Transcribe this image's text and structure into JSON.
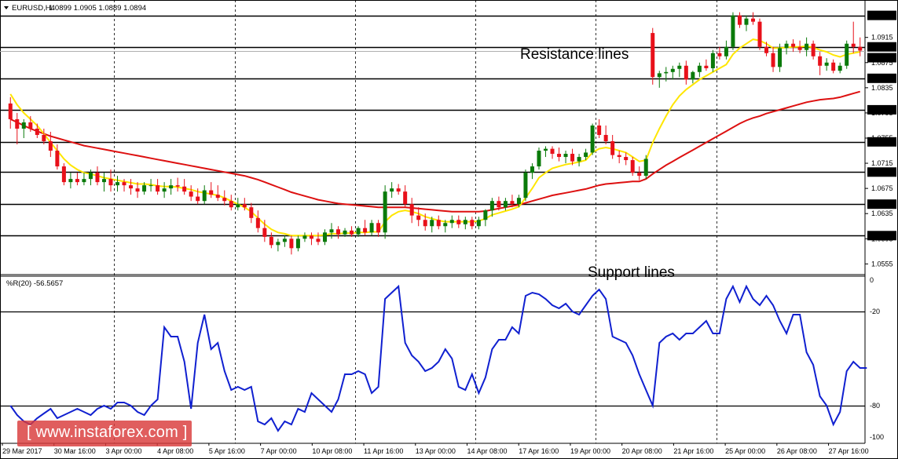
{
  "header": {
    "symbol": "EURUSD,H4",
    "ohlc": "1.0899 1.0905 1.0889 1.0894"
  },
  "annotations": {
    "resistance": "Resistance lines",
    "support": "Support lines"
  },
  "watermark": "[ www.instaforex.com ]",
  "colors": {
    "bull": "#0a7a0a",
    "bear": "#e8101a",
    "ma_fast": "#ffe600",
    "ma_slow": "#dd1010",
    "wpr": "#1020d0",
    "hline": "#000000"
  },
  "chart_data": [
    {
      "type": "candlestick",
      "title": "EURUSD,H4",
      "ylim": [
        1.0538,
        1.0962
      ],
      "price_ticks": [
        "1.0915",
        "1.0875",
        "1.0835",
        "1.0795",
        "1.0755",
        "1.0715",
        "1.0675",
        "1.0635",
        "1.0595",
        "1.0555"
      ],
      "highlighted_levels": [
        "1.0950",
        "1.0900",
        "1.0850",
        "1.0800",
        "1.0749",
        "1.0701",
        "1.0650",
        "1.0600"
      ],
      "current_price": "1.0894",
      "levels": [
        1.095,
        1.09,
        1.085,
        1.08,
        1.0749,
        1.0701,
        1.065,
        1.06
      ],
      "time_labels": [
        "29 Mar 2017",
        "30 Mar 16:00",
        "3 Apr 00:00",
        "4 Apr 08:00",
        "5 Apr 16:00",
        "7 Apr 00:00",
        "10 Apr 08:00",
        "11 Apr 16:00",
        "13 Apr 00:00",
        "14 Apr 08:00",
        "17 Apr 16:00",
        "19 Apr 00:00",
        "20 Apr 08:00",
        "21 Apr 16:00",
        "25 Apr 00:00",
        "26 Apr 08:00",
        "27 Apr 16:00"
      ],
      "candles": [
        [
          1.081,
          1.082,
          1.077,
          1.0785
        ],
        [
          1.0785,
          1.0795,
          1.0745,
          1.077
        ],
        [
          1.077,
          1.0785,
          1.0755,
          1.078
        ],
        [
          1.078,
          1.079,
          1.0765,
          1.077
        ],
        [
          1.077,
          1.0778,
          1.0755,
          1.076
        ],
        [
          1.076,
          1.077,
          1.0745,
          1.075
        ],
        [
          1.075,
          1.0765,
          1.0725,
          1.0735
        ],
        [
          1.0735,
          1.0745,
          1.0705,
          1.071
        ],
        [
          1.071,
          1.0715,
          1.068,
          1.0685
        ],
        [
          1.0685,
          1.07,
          1.0675,
          1.069
        ],
        [
          1.069,
          1.07,
          1.068,
          1.0685
        ],
        [
          1.0685,
          1.07,
          1.068,
          1.069
        ],
        [
          1.069,
          1.0705,
          1.068,
          1.07
        ],
        [
          1.07,
          1.071,
          1.068,
          1.0685
        ],
        [
          1.0685,
          1.07,
          1.067,
          1.069
        ],
        [
          1.069,
          1.0705,
          1.067,
          1.068
        ],
        [
          1.068,
          1.0695,
          1.067,
          1.0685
        ],
        [
          1.0685,
          1.069,
          1.067,
          1.068
        ],
        [
          1.068,
          1.069,
          1.0665,
          1.0675
        ],
        [
          1.0675,
          1.0685,
          1.066,
          1.067
        ],
        [
          1.067,
          1.0685,
          1.0665,
          1.068
        ],
        [
          1.068,
          1.069,
          1.067,
          1.068
        ],
        [
          1.068,
          1.069,
          1.0665,
          1.067
        ],
        [
          1.067,
          1.0685,
          1.066,
          1.0675
        ],
        [
          1.0675,
          1.069,
          1.0665,
          1.068
        ],
        [
          1.068,
          1.0692,
          1.067,
          1.0678
        ],
        [
          1.0678,
          1.069,
          1.0665,
          1.067
        ],
        [
          1.067,
          1.068,
          1.0655,
          1.0662
        ],
        [
          1.0662,
          1.0675,
          1.065,
          1.0655
        ],
        [
          1.0655,
          1.068,
          1.065,
          1.0672
        ],
        [
          1.0672,
          1.0685,
          1.066,
          1.0665
        ],
        [
          1.0665,
          1.068,
          1.0655,
          1.066
        ],
        [
          1.066,
          1.0672,
          1.0648,
          1.0655
        ],
        [
          1.0655,
          1.0665,
          1.064,
          1.0645
        ],
        [
          1.0645,
          1.066,
          1.064,
          1.065
        ],
        [
          1.065,
          1.066,
          1.064,
          1.0645
        ],
        [
          1.0645,
          1.0652,
          1.062,
          1.0628
        ],
        [
          1.0628,
          1.064,
          1.0605,
          1.0612
        ],
        [
          1.0612,
          1.0625,
          1.059,
          1.0598
        ],
        [
          1.0598,
          1.0605,
          1.058,
          1.0585
        ],
        [
          1.0585,
          1.0595,
          1.0575,
          1.059
        ],
        [
          1.059,
          1.06,
          1.0582,
          1.0595
        ],
        [
          1.0595,
          1.06,
          1.057,
          1.058
        ],
        [
          1.058,
          1.06,
          1.0575,
          1.0595
        ],
        [
          1.0595,
          1.0605,
          1.059,
          1.06
        ],
        [
          1.06,
          1.0605,
          1.0585,
          1.0595
        ],
        [
          1.0595,
          1.0605,
          1.0585,
          1.059
        ],
        [
          1.059,
          1.061,
          1.0585,
          1.0605
        ],
        [
          1.0605,
          1.062,
          1.0595,
          1.061
        ],
        [
          1.061,
          1.0615,
          1.0595,
          1.0602
        ],
        [
          1.0602,
          1.0612,
          1.0598,
          1.0608
        ],
        [
          1.0608,
          1.0615,
          1.0598,
          1.0602
        ],
        [
          1.0602,
          1.0615,
          1.0598,
          1.0612
        ],
        [
          1.0612,
          1.0625,
          1.06,
          1.0605
        ],
        [
          1.0605,
          1.0625,
          1.06,
          1.062
        ],
        [
          1.062,
          1.0625,
          1.0598,
          1.0605
        ],
        [
          1.0605,
          1.068,
          1.0595,
          1.067
        ],
        [
          1.067,
          1.0685,
          1.066,
          1.0675
        ],
        [
          1.0675,
          1.0682,
          1.0665,
          1.067
        ],
        [
          1.067,
          1.068,
          1.0645,
          1.065
        ],
        [
          1.065,
          1.066,
          1.062,
          1.0632
        ],
        [
          1.0632,
          1.0645,
          1.0615,
          1.0625
        ],
        [
          1.0625,
          1.0635,
          1.0608,
          1.0615
        ],
        [
          1.0615,
          1.063,
          1.0605,
          1.0625
        ],
        [
          1.0625,
          1.0632,
          1.061,
          1.0615
        ],
        [
          1.0615,
          1.0625,
          1.0605,
          1.062
        ],
        [
          1.062,
          1.0632,
          1.0612,
          1.0625
        ],
        [
          1.0625,
          1.0632,
          1.0612,
          1.0618
        ],
        [
          1.0618,
          1.063,
          1.061,
          1.0625
        ],
        [
          1.0625,
          1.063,
          1.061,
          1.0615
        ],
        [
          1.0615,
          1.063,
          1.061,
          1.0625
        ],
        [
          1.0625,
          1.0642,
          1.0615,
          1.064
        ],
        [
          1.064,
          1.066,
          1.063,
          1.0655
        ],
        [
          1.0655,
          1.0662,
          1.064,
          1.0645
        ],
        [
          1.0645,
          1.066,
          1.064,
          1.0655
        ],
        [
          1.0655,
          1.0665,
          1.0645,
          1.065
        ],
        [
          1.065,
          1.0665,
          1.0645,
          1.066
        ],
        [
          1.066,
          1.0705,
          1.0655,
          1.07
        ],
        [
          1.07,
          1.0715,
          1.069,
          1.071
        ],
        [
          1.071,
          1.074,
          1.0705,
          1.0735
        ],
        [
          1.0735,
          1.0742,
          1.0725,
          1.0738
        ],
        [
          1.0738,
          1.0742,
          1.0722,
          1.073
        ],
        [
          1.073,
          1.074,
          1.0718,
          1.0725
        ],
        [
          1.0725,
          1.0735,
          1.0715,
          1.073
        ],
        [
          1.073,
          1.0738,
          1.0712,
          1.0718
        ],
        [
          1.0718,
          1.073,
          1.071,
          1.0725
        ],
        [
          1.0725,
          1.0738,
          1.072,
          1.0732
        ],
        [
          1.0732,
          1.0778,
          1.0728,
          1.0775
        ],
        [
          1.0775,
          1.0785,
          1.0755,
          1.076
        ],
        [
          1.076,
          1.0775,
          1.0745,
          1.075
        ],
        [
          1.075,
          1.076,
          1.0722,
          1.0728
        ],
        [
          1.0728,
          1.0735,
          1.0715,
          1.0725
        ],
        [
          1.0725,
          1.0732,
          1.0712,
          1.072
        ],
        [
          1.072,
          1.0725,
          1.0695,
          1.07
        ],
        [
          1.07,
          1.071,
          1.0688,
          1.0695
        ],
        [
          1.0695,
          1.0728,
          1.069,
          1.0722
        ],
        [
          1.0922,
          1.093,
          1.084,
          1.0852
        ],
        [
          1.0852,
          1.0862,
          1.0835,
          1.0858
        ],
        [
          1.0858,
          1.0868,
          1.0845,
          1.086
        ],
        [
          1.086,
          1.087,
          1.0848,
          1.0865
        ],
        [
          1.0865,
          1.0875,
          1.0852,
          1.087
        ],
        [
          1.087,
          1.0878,
          1.084,
          1.0848
        ],
        [
          1.0848,
          1.0862,
          1.0842,
          1.086
        ],
        [
          1.086,
          1.0875,
          1.0852,
          1.087
        ],
        [
          1.087,
          1.088,
          1.0862,
          1.0866
        ],
        [
          1.0866,
          1.0895,
          1.086,
          1.089
        ],
        [
          1.089,
          1.09,
          1.088,
          1.0885
        ],
        [
          1.0885,
          1.091,
          1.088,
          1.09
        ],
        [
          1.09,
          1.0955,
          1.0895,
          1.095
        ],
        [
          1.095,
          1.0955,
          1.093,
          1.0935
        ],
        [
          1.0935,
          1.095,
          1.0925,
          1.0945
        ],
        [
          1.0945,
          1.0955,
          1.0935,
          1.094
        ],
        [
          1.094,
          1.0945,
          1.0895,
          1.09
        ],
        [
          1.09,
          1.0908,
          1.0885,
          1.089
        ],
        [
          1.089,
          1.09,
          1.086,
          1.0868
        ],
        [
          1.0868,
          1.0905,
          1.086,
          1.0898
        ],
        [
          1.0898,
          1.091,
          1.0888,
          1.0905
        ],
        [
          1.0905,
          1.0912,
          1.0892,
          1.09
        ],
        [
          1.09,
          1.091,
          1.089,
          1.0895
        ],
        [
          1.0895,
          1.0915,
          1.0885,
          1.0905
        ],
        [
          1.0905,
          1.091,
          1.088,
          1.0885
        ],
        [
          1.0885,
          1.0892,
          1.0855,
          1.087
        ],
        [
          1.087,
          1.0882,
          1.0862,
          1.0875
        ],
        [
          1.0875,
          1.088,
          1.0858,
          1.0862
        ],
        [
          1.0862,
          1.0875,
          1.0858,
          1.087
        ],
        [
          1.087,
          1.091,
          1.0865,
          1.0905
        ],
        [
          1.0905,
          1.094,
          1.089,
          1.09
        ],
        [
          1.09,
          1.0915,
          1.0885,
          1.0894
        ]
      ],
      "ma_fast": [
        1.0825,
        1.0808,
        1.0795,
        1.0785,
        1.0775,
        1.0762,
        1.0748,
        1.0735,
        1.0722,
        1.0712,
        1.0705,
        1.07,
        1.0698,
        1.0695,
        1.0692,
        1.069,
        1.0688,
        1.0686,
        1.0684,
        1.0682,
        1.0682,
        1.0681,
        1.0679,
        1.0678,
        1.0678,
        1.0677,
        1.0675,
        1.0673,
        1.067,
        1.0668,
        1.0666,
        1.0664,
        1.066,
        1.0655,
        1.065,
        1.0645,
        1.0638,
        1.0628,
        1.0618,
        1.061,
        1.0605,
        1.0603,
        1.06,
        1.06,
        1.06,
        1.06,
        1.06,
        1.0601,
        1.0603,
        1.0603,
        1.0604,
        1.0604,
        1.0605,
        1.0605,
        1.0606,
        1.0606,
        1.0622,
        1.0632,
        1.0638,
        1.064,
        1.0638,
        1.0635,
        1.063,
        1.0627,
        1.0624,
        1.0622,
        1.0622,
        1.0622,
        1.0622,
        1.0622,
        1.0623,
        1.0627,
        1.0633,
        1.0636,
        1.0639,
        1.0642,
        1.0646,
        1.066,
        1.0675,
        1.0692,
        1.07,
        1.0707,
        1.071,
        1.0713,
        1.0715,
        1.0717,
        1.072,
        1.0732,
        1.0738,
        1.074,
        1.0738,
        1.0735,
        1.0732,
        1.0725,
        1.0718,
        1.072,
        1.0748,
        1.077,
        1.079,
        1.0808,
        1.0822,
        1.0832,
        1.084,
        1.0848,
        1.0854,
        1.086,
        1.0866,
        1.0872,
        1.0888,
        1.0898,
        1.0905,
        1.0912,
        1.091,
        1.0905,
        1.0898,
        1.0898,
        1.0899,
        1.09,
        1.09,
        1.0901,
        1.0899,
        1.0895,
        1.0892,
        1.0887,
        1.0884,
        1.0888,
        1.089,
        1.0892
      ],
      "ma_slow": [
        1.0785,
        1.078,
        1.0775,
        1.077,
        1.0766,
        1.0762,
        1.0758,
        1.0755,
        1.0752,
        1.0749,
        1.0746,
        1.0743,
        1.0741,
        1.0739,
        1.0737,
        1.0735,
        1.0733,
        1.0731,
        1.0729,
        1.0727,
        1.0725,
        1.0723,
        1.0721,
        1.0719,
        1.0717,
        1.0715,
        1.0713,
        1.0711,
        1.0709,
        1.0707,
        1.0705,
        1.0703,
        1.0701,
        1.0699,
        1.0697,
        1.0695,
        1.0692,
        1.0689,
        1.0685,
        1.0681,
        1.0677,
        1.0673,
        1.0669,
        1.0666,
        1.0663,
        1.066,
        1.0657,
        1.0655,
        1.0653,
        1.0651,
        1.065,
        1.0649,
        1.0648,
        1.0647,
        1.0646,
        1.0645,
        1.0645,
        1.0645,
        1.0645,
        1.0645,
        1.0644,
        1.0643,
        1.0642,
        1.0641,
        1.064,
        1.0639,
        1.0638,
        1.0638,
        1.0638,
        1.0638,
        1.0638,
        1.0639,
        1.0641,
        1.0643,
        1.0645,
        1.0647,
        1.0649,
        1.0652,
        1.0655,
        1.0658,
        1.0661,
        1.0664,
        1.0666,
        1.0668,
        1.067,
        1.0672,
        1.0674,
        1.0677,
        1.068,
        1.0682,
        1.0683,
        1.0684,
        1.0685,
        1.0686,
        1.0686,
        1.069,
        1.0698,
        1.0705,
        1.0712,
        1.0718,
        1.0724,
        1.073,
        1.0736,
        1.0742,
        1.0748,
        1.0754,
        1.076,
        1.0766,
        1.0772,
        1.0778,
        1.0783,
        1.0787,
        1.079,
        1.0794,
        1.0797,
        1.08,
        1.0803,
        1.0806,
        1.0809,
        1.0812,
        1.0814,
        1.0816,
        1.0817,
        1.0818,
        1.082,
        1.0823,
        1.0826,
        1.0829
      ],
      "separators": [
        16,
        34,
        52,
        70,
        88,
        106
      ]
    },
    {
      "type": "line",
      "title": "%R(20) -56.5657",
      "ylim": [
        -100,
        0
      ],
      "ticks": [
        "0",
        "-20",
        "-80",
        "-100"
      ],
      "levels": [
        -20,
        -80
      ],
      "values": [
        -80,
        -86,
        -90,
        -92,
        -88,
        -85,
        -82,
        -88,
        -86,
        -84,
        -82,
        -84,
        -86,
        -82,
        -80,
        -82,
        -78,
        -78,
        -80,
        -84,
        -86,
        -80,
        -76,
        -30,
        -36,
        -36,
        -52,
        -82,
        -40,
        -22,
        -44,
        -40,
        -58,
        -70,
        -68,
        -70,
        -68,
        -90,
        -92,
        -88,
        -96,
        -90,
        -92,
        -82,
        -84,
        -72,
        -76,
        -80,
        -84,
        -76,
        -60,
        -60,
        -58,
        -60,
        -72,
        -68,
        -12,
        -8,
        -4,
        -40,
        -48,
        -52,
        -58,
        -56,
        -52,
        -44,
        -50,
        -68,
        -70,
        -60,
        -72,
        -62,
        -44,
        -38,
        -38,
        -30,
        -34,
        -10,
        -8,
        -9,
        -12,
        -16,
        -18,
        -15,
        -20,
        -22,
        -16,
        -10,
        -6,
        -12,
        -36,
        -38,
        -40,
        -48,
        -60,
        -70,
        -80,
        -40,
        -36,
        -34,
        -38,
        -34,
        -34,
        -30,
        -26,
        -34,
        -34,
        -12,
        -4,
        -14,
        -4,
        -12,
        -16,
        -10,
        -16,
        -26,
        -34,
        -22,
        -22,
        -46,
        -54,
        -74,
        -80,
        -92,
        -84,
        -58,
        -52,
        -56,
        -56
      ]
    }
  ]
}
